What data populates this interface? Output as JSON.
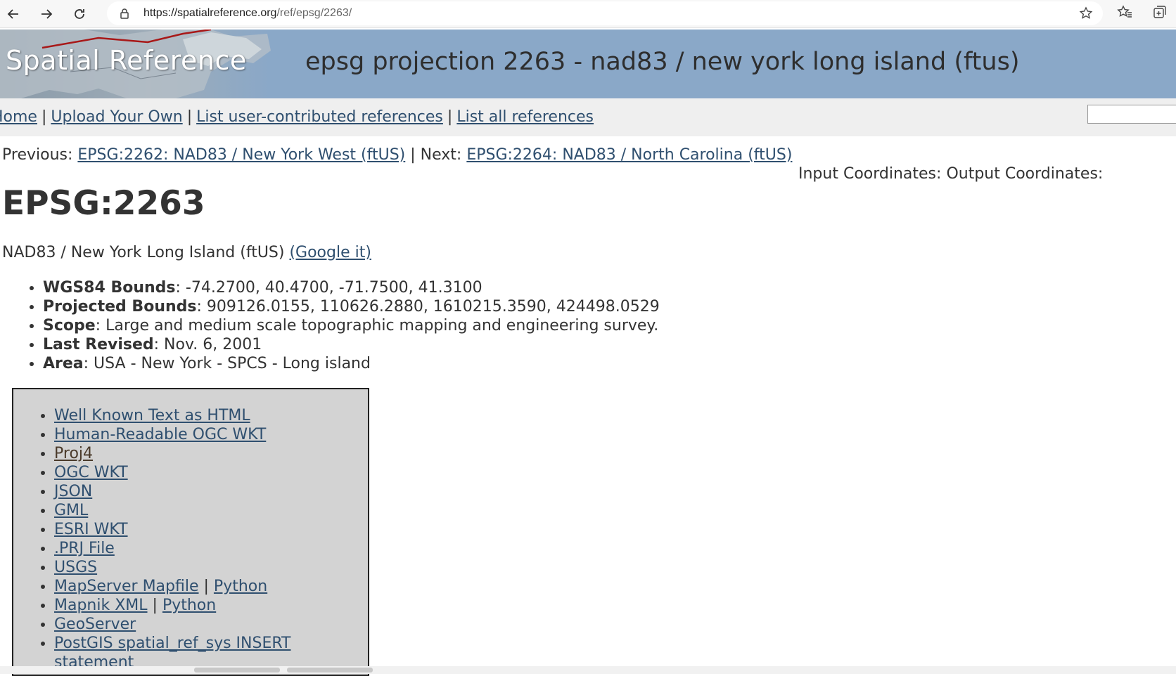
{
  "browser": {
    "url_host": "https://spatialreference.org",
    "url_path": "/ref/epsg/2263/"
  },
  "banner": {
    "logo_text": "Spatial Reference",
    "title": "epsg projection 2263 - nad83 / new york long island (ftus)"
  },
  "nav": {
    "home": "Home",
    "upload": "Upload Your Own",
    "user_refs": "List user-contributed references",
    "all_refs": "List all references",
    "sep": "|"
  },
  "prevnext": {
    "prev_label": "Previous:",
    "prev_link": "EPSG:2262: NAD83 / New York West (ftUS)",
    "sep": "|",
    "next_label": "Next:",
    "next_link": "EPSG:2264: NAD83 / North Carolina (ftUS)"
  },
  "coords": {
    "input": "Input Coordinates:",
    "output": "Output Coordinates:"
  },
  "page": {
    "code": "EPSG:2263",
    "name": "NAD83 / New York Long Island (ftUS)",
    "google": "(Google it)"
  },
  "properties": [
    {
      "label": "WGS84 Bounds",
      "value": ": -74.2700, 40.4700, -71.7500, 41.3100"
    },
    {
      "label": "Projected Bounds",
      "value": ": 909126.0155, 110626.2880, 1610215.3590, 424498.0529"
    },
    {
      "label": "Scope",
      "value": ": Large and medium scale topographic mapping and engineering survey."
    },
    {
      "label": "Last Revised",
      "value": ": Nov. 6, 2001"
    },
    {
      "label": "Area",
      "value": ": USA - New York - SPCS - Long island"
    }
  ],
  "formats": {
    "wkt_html": "Well Known Text as HTML",
    "human_wkt": "Human-Readable OGC WKT",
    "proj4": "Proj4",
    "ogc_wkt": "OGC WKT",
    "json": "JSON",
    "gml": "GML",
    "esri_wkt": "ESRI WKT",
    "prj": ".PRJ File",
    "usgs": "USGS",
    "mapfile": "MapServer Mapfile",
    "mapfile_python": "Python",
    "mapnik": "Mapnik XML",
    "mapnik_python": "Python",
    "geoserver": "GeoServer",
    "postgis_1": "PostGIS spatial_ref_sys INSERT",
    "postgis_2": "statement",
    "sep": "|"
  }
}
